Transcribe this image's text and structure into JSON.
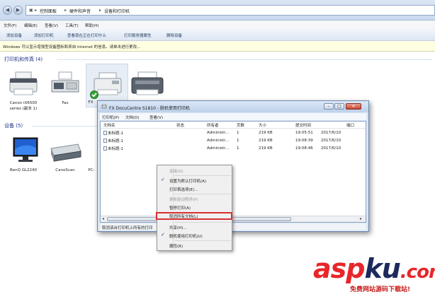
{
  "address": {
    "crumbs": [
      "控制面板",
      "硬件和声音",
      "设备和打印机"
    ]
  },
  "menubar": [
    "文件(F)",
    "编辑(E)",
    "查看(V)",
    "工具(T)",
    "帮助(H)"
  ],
  "commands": [
    "添加设备",
    "添加打印机",
    "查看现在正在打印什么",
    "打印服务器属性",
    "删除设备"
  ],
  "infobar": "Windows 可以显示增强型设备图标和来自 Internet 的信息。请单击进行更改...",
  "groups": {
    "printers": "打印机和传真 (4)",
    "devices": "设备 (5)"
  },
  "printers": [
    {
      "label1": "Canon iX6500",
      "label2": "series (副本 1)"
    },
    {
      "label1": "Fax",
      "label2": ""
    },
    {
      "label1": "FX",
      "label2": ""
    },
    {
      "label1": "",
      "label2": ""
    }
  ],
  "devices": [
    {
      "label": "BenQ GL2240"
    },
    {
      "label": "CanoScan"
    },
    {
      "label": "PC-"
    }
  ],
  "queue": {
    "title": "FX DocuCentre S1810 - 脱机使用打印机",
    "menu": [
      "打印机(P)",
      "文档(D)",
      "查看(V)"
    ],
    "headers": [
      "文档名",
      "状态",
      "所有者",
      "页数",
      "大小",
      "提交时间",
      "端口"
    ],
    "rows": [
      {
        "name": "未标题-1",
        "owner": "Administr...",
        "pages": "1",
        "size": "219 KB",
        "time": "19:05:51",
        "date": "2017/6/10"
      },
      {
        "name": "未标题-1",
        "owner": "Administr...",
        "pages": "1",
        "size": "219 KB",
        "time": "19:08:39",
        "date": "2017/6/10"
      },
      {
        "name": "未标题-1",
        "owner": "Administr...",
        "pages": "1",
        "size": "219 KB",
        "time": "19:08:46",
        "date": "2017/6/10"
      }
    ],
    "status": "取消该台打印机上所有的打印"
  },
  "context_menu": {
    "items": [
      {
        "label": "连接(O)",
        "disabled": true,
        "checked": false
      },
      {
        "label": "设置为默认打印机(A)",
        "disabled": false,
        "checked": true
      },
      {
        "label": "打印首选项(E)...",
        "disabled": false,
        "checked": false
      },
      {
        "label": "更新驱动程序(P)",
        "disabled": true,
        "checked": false
      },
      {
        "label": "暂停打印(A)",
        "disabled": false,
        "checked": false
      },
      {
        "label": "取消所有文档(L)",
        "disabled": false,
        "checked": false,
        "highlighted": true
      },
      {
        "label": "共享(H)...",
        "disabled": false,
        "checked": false
      },
      {
        "label": "脱机使用打印机(U)",
        "disabled": false,
        "checked": true
      },
      {
        "label": "属性(R)",
        "disabled": false,
        "checked": false
      }
    ]
  },
  "watermark": {
    "brand_a": "asp",
    "brand_b": "ku",
    "brand_c": ".com",
    "tagline": "免费网站源码下载站!"
  },
  "colors": {
    "highlight_box": "#d93030",
    "group_heading": "#1e3287",
    "watermark_red": "#e8262a",
    "watermark_navy": "#1c2a5e"
  }
}
